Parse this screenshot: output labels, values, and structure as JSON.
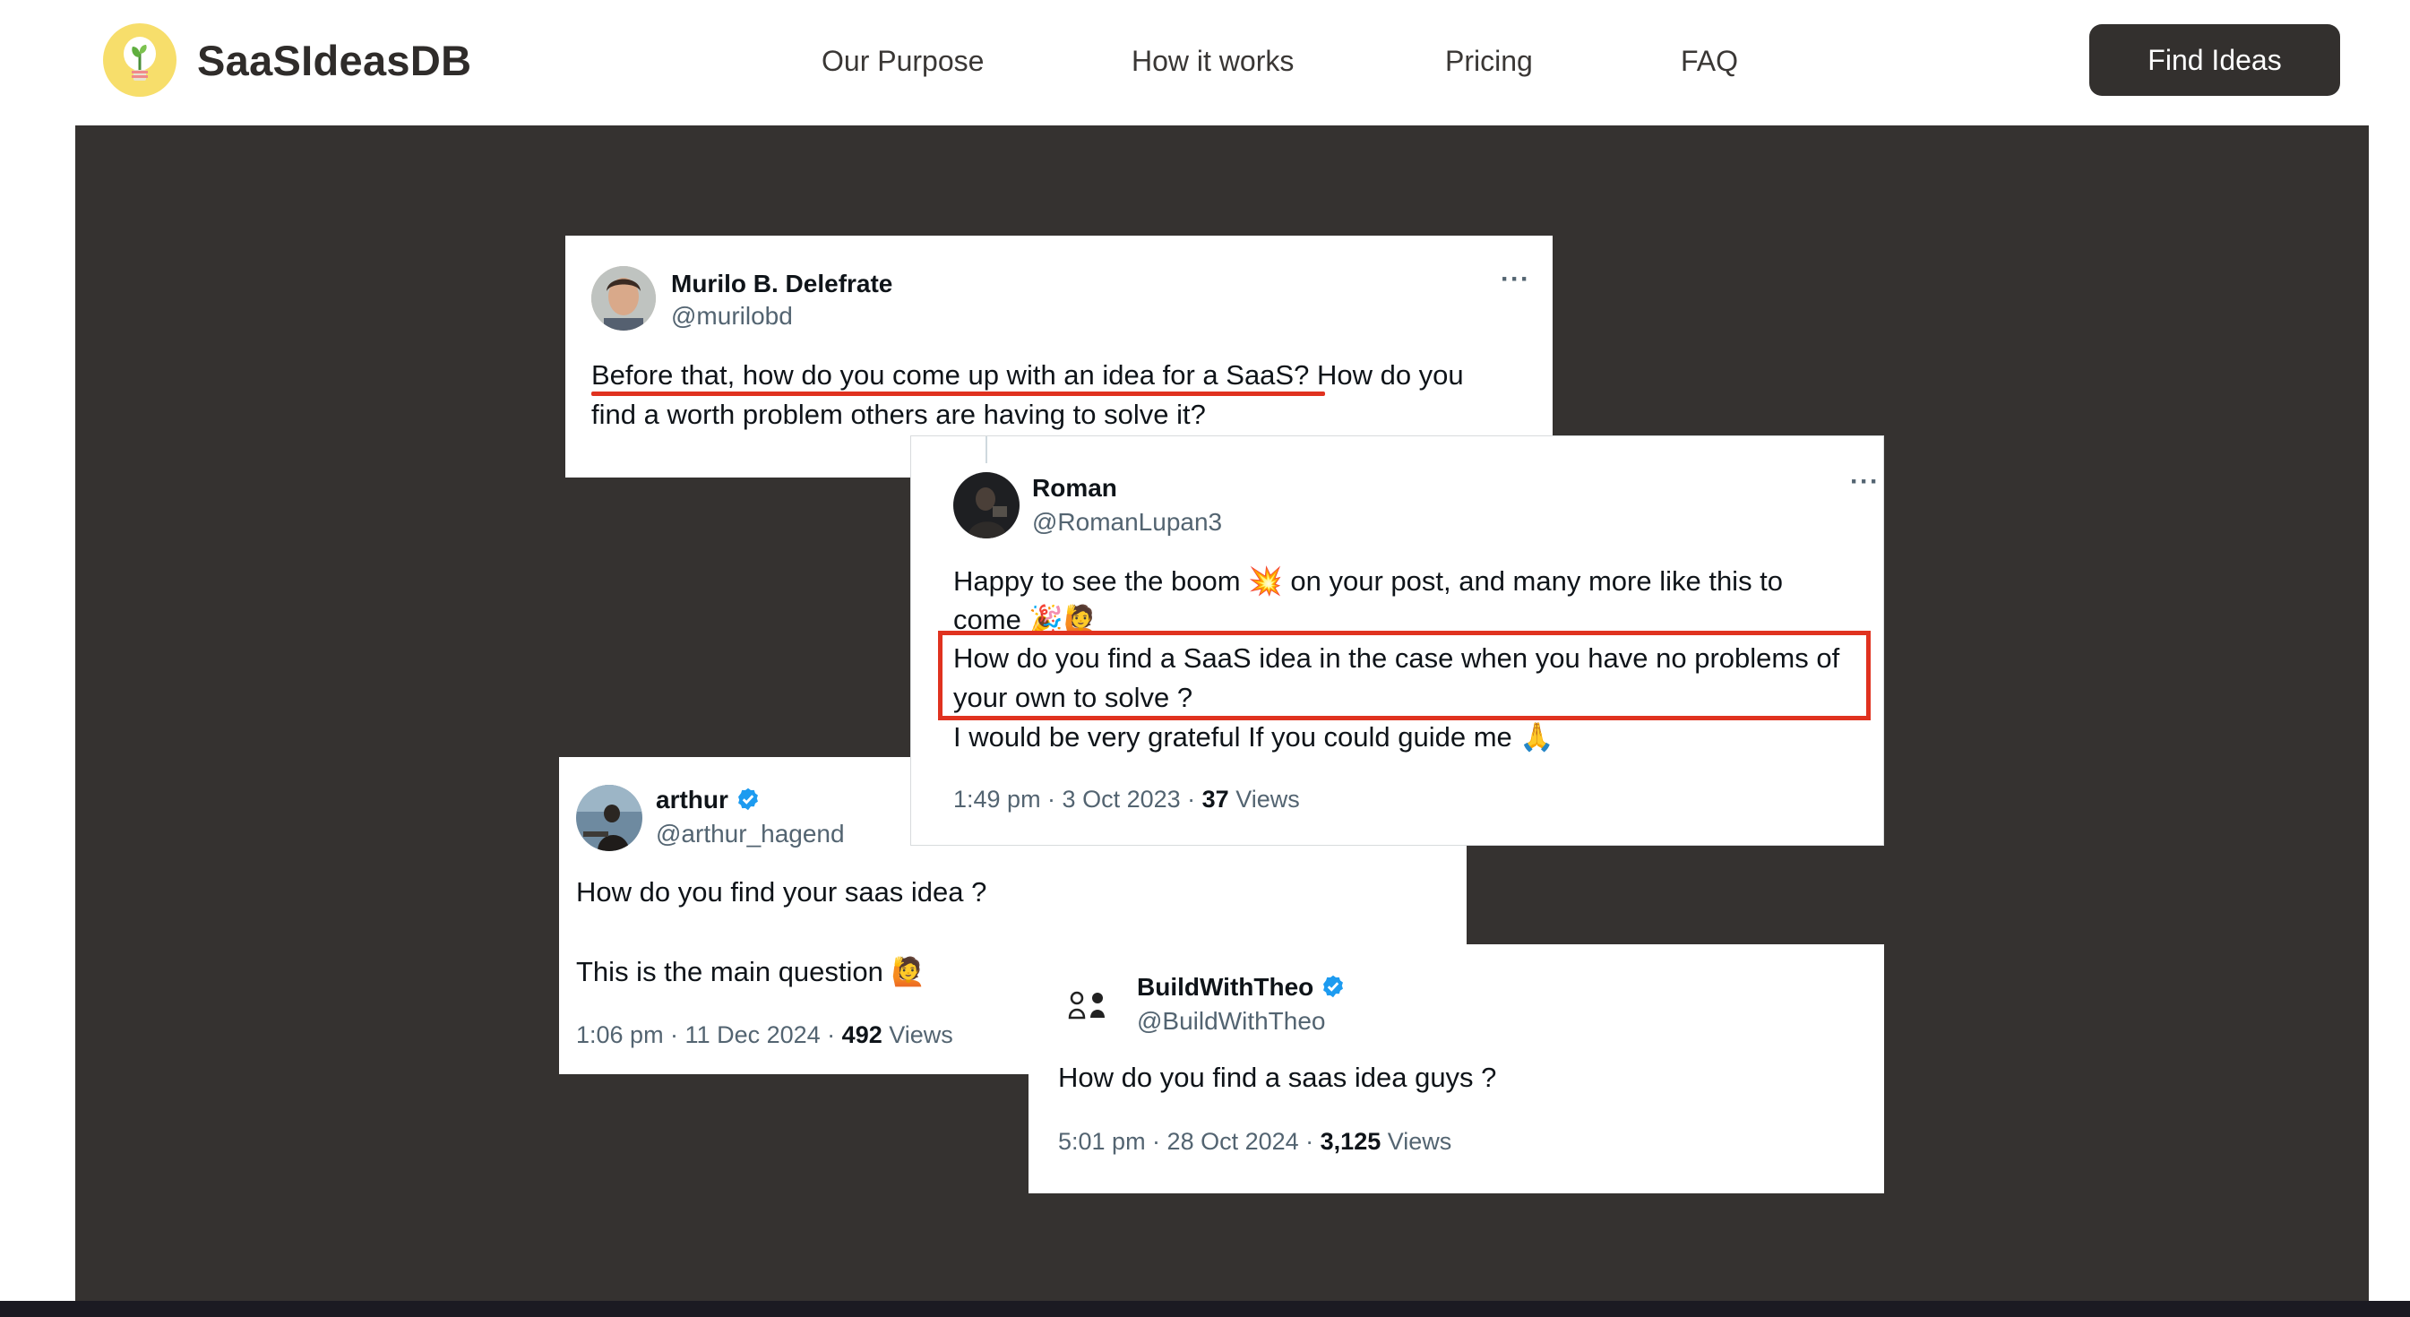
{
  "nav": {
    "brand": "SaaSIdeasDB",
    "links": [
      "Our Purpose",
      "How it works",
      "Pricing",
      "FAQ"
    ],
    "cta": "Find Ideas"
  },
  "tweets": {
    "murilo": {
      "name": "Murilo B. Delefrate",
      "handle": "@murilobd",
      "line1": "Before that, how do you come up with an idea for a SaaS? How do you",
      "line2": "find a worth problem others are having to solve it?"
    },
    "roman": {
      "name": "Roman",
      "handle": "@RomanLupan3",
      "line1a": "Happy to see the boom ",
      "line1b": " on your post, and many more like this to",
      "line2": "come ",
      "line3": "How do you find a SaaS idea in the case when you have no problems of",
      "line4": "your own to solve ?",
      "line5": "I would be very grateful If you could guide me ",
      "time": "1:49 pm · 3 Oct 2023 · ",
      "views_count": "37",
      "views_label": " Views"
    },
    "arthur": {
      "name": "arthur",
      "handle": "@arthur_hagend",
      "line1": "How do you find your saas idea ?",
      "line2": "This is the main question ",
      "time": "1:06 pm · 11 Dec 2024 · ",
      "views_count": "492",
      "views_label": " Views"
    },
    "theo": {
      "name": "BuildWithTheo",
      "handle": "@BuildWithTheo",
      "line1": "How do you find a saas idea guys ?",
      "time": "5:01 pm · 28 Oct 2024 · ",
      "views_count": "3,125",
      "views_label": " Views"
    }
  },
  "icons": {
    "logo": "lightbulb-sprout-icon",
    "more": "more-horizontal-icon",
    "verified": "verified-badge-icon"
  },
  "colors": {
    "hero_bg": "#353230",
    "cta_bg": "#33302e",
    "highlight_red": "#e0321f",
    "verified_blue": "#1d9bf0",
    "logo_yellow": "#f7de6b"
  }
}
